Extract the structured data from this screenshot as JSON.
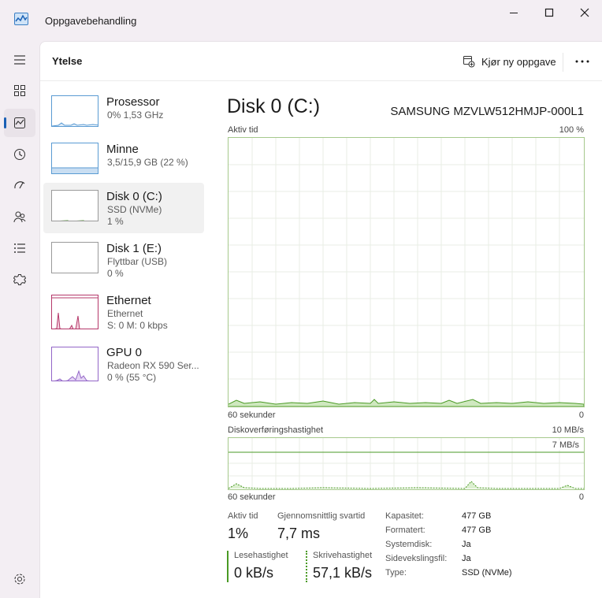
{
  "window": {
    "title": "Oppgavebehandling"
  },
  "nav": {
    "items": [
      {
        "name": "hamburger-menu-icon"
      },
      {
        "name": "processes-icon"
      },
      {
        "name": "performance-icon",
        "active": true
      },
      {
        "name": "app-history-icon"
      },
      {
        "name": "startup-apps-icon"
      },
      {
        "name": "users-icon"
      },
      {
        "name": "details-icon"
      },
      {
        "name": "services-icon"
      }
    ],
    "settings": "settings-icon"
  },
  "header": {
    "title": "Ytelse",
    "new_task": "Kjør ny oppgave"
  },
  "sidebar": [
    {
      "name": "Prosessor",
      "sub1": "0%  1,53 GHz",
      "sub2": ""
    },
    {
      "name": "Minne",
      "sub1": "3,5/15,9 GB (22 %)",
      "sub2": ""
    },
    {
      "name": "Disk 0 (C:)",
      "sub1": "SSD (NVMe)",
      "sub2": "1 %"
    },
    {
      "name": "Disk 1 (E:)",
      "sub1": "Flyttbar (USB)",
      "sub2": "0 %"
    },
    {
      "name": "Ethernet",
      "sub1": "Ethernet",
      "sub2": "S: 0 M: 0 kbps"
    },
    {
      "name": "GPU 0",
      "sub1": "Radeon RX 590 Ser...",
      "sub2": "0 % (55 °C)"
    }
  ],
  "panel": {
    "title": "Disk 0 (C:)",
    "model": "SAMSUNG MZVLW512HMJP-000L1",
    "active_time": {
      "label": "Aktiv tid",
      "max": "100 %",
      "time": "60 sekunder",
      "min": "0"
    },
    "transfer": {
      "label": "Diskoverføringshastighet",
      "max": "10 MB/s",
      "line": "7 MB/s",
      "time": "60 sekunder",
      "min": "0"
    },
    "stats": {
      "active_label": "Aktiv tid",
      "active_value": "1%",
      "response_label": "Gjennomsnittlig svartid",
      "response_value": "7,7 ms",
      "read_label": "Lesehastighet",
      "read_value": "0 kB/s",
      "write_label": "Skrivehastighet",
      "write_value": "57,1 kB/s"
    },
    "info": [
      {
        "k": "Kapasitet:",
        "v": "477 GB"
      },
      {
        "k": "Formatert:",
        "v": "477 GB"
      },
      {
        "k": "Systemdisk:",
        "v": "Ja"
      },
      {
        "k": "Sidevekslingsfil:",
        "v": "Ja"
      },
      {
        "k": "Type:",
        "v": "SSD (NVMe)"
      }
    ]
  },
  "colors": {
    "accent": "#1a60b5",
    "disk_graph": "#4a9a24",
    "ethernet_graph": "#b5386a",
    "gpu_graph": "#9366c7",
    "cpu_graph": "#5a9bd3"
  }
}
